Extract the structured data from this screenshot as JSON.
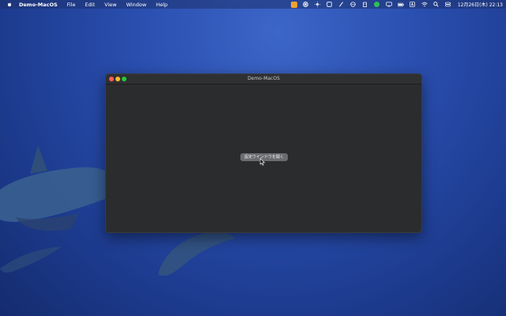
{
  "menubar": {
    "app_name": "Demo-MacOS",
    "items": [
      "File",
      "Edit",
      "View",
      "Window",
      "Help"
    ],
    "clock": "12月26日(木) 22:13"
  },
  "status_icons": [
    "app-badge-icon",
    "record-icon",
    "sun-icon",
    "box-icon",
    "pen-icon",
    "globe-icon",
    "clipboard-icon",
    "spotify-icon",
    "display-icon",
    "battery-icon",
    "text-input-icon",
    "wifi-icon",
    "search-icon",
    "control-center-icon"
  ],
  "window": {
    "title": "Demo-MacOS",
    "button_label": "設定ウインドウを開く"
  },
  "colors": {
    "close": "#ff5f57",
    "minimize": "#febc2e",
    "maximize": "#28c840"
  }
}
